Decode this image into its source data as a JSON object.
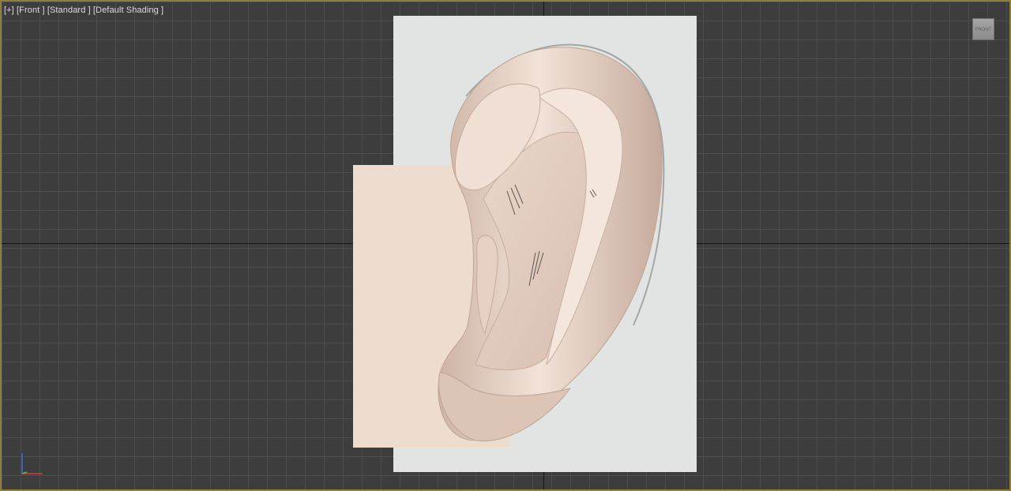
{
  "viewport": {
    "label_plus": "[+]",
    "label_view": "[Front ]",
    "label_style": "[Standard ]",
    "label_shading": "[Default Shading ]"
  },
  "viewcube": {
    "face_label": "FRONT"
  },
  "colors": {
    "grid_background": "#3d3d3d",
    "grid_line": "#4d4d4d",
    "axis_line": "#141414",
    "active_border": "#8f7d3a",
    "reference_plane": "#e2e4e3",
    "skin_plane": "#eedcce",
    "ear_skin": "#e8d2c4"
  },
  "icons": {
    "axis_tripod": "xyz-axis-icon",
    "viewcube": "viewcube-icon"
  }
}
